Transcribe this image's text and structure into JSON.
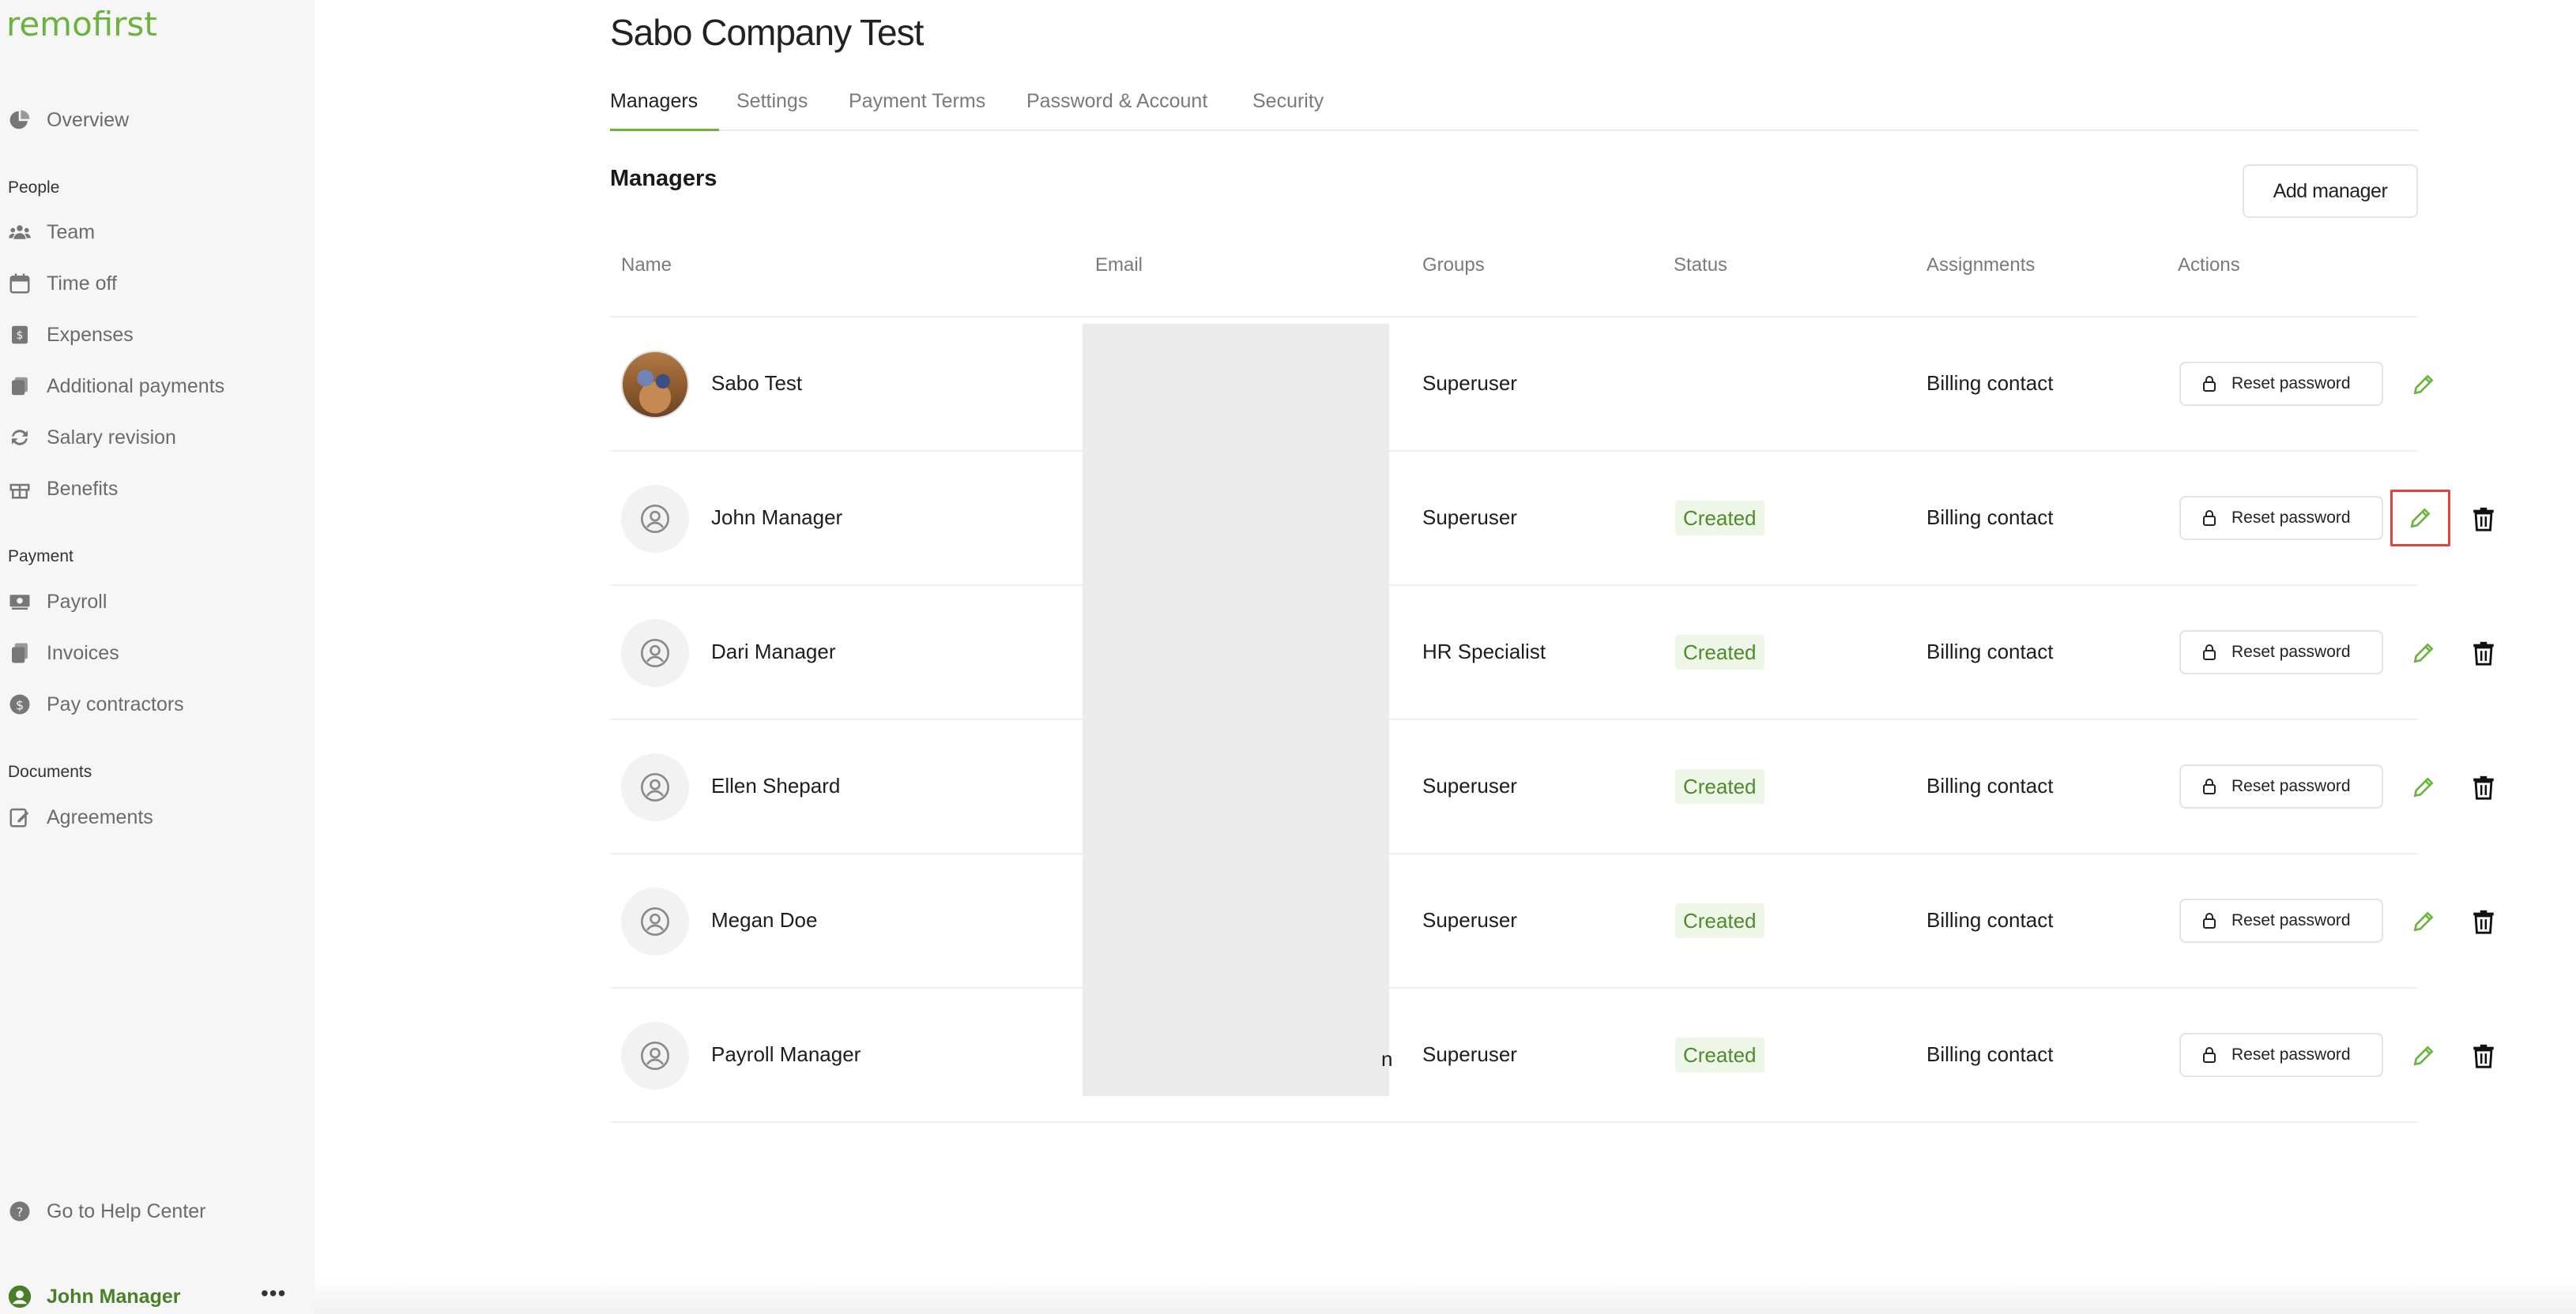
{
  "app": {
    "logo": "remofirst"
  },
  "sidebar": {
    "overview": "Overview",
    "sections": {
      "people": "People",
      "payment": "Payment",
      "documents": "Documents"
    },
    "people_items": [
      "Team",
      "Time off",
      "Expenses",
      "Additional payments",
      "Salary revision",
      "Benefits"
    ],
    "payment_items": [
      "Payroll",
      "Invoices",
      "Pay contractors"
    ],
    "documents_items": [
      "Agreements"
    ],
    "help": "Go to Help Center",
    "user": "John Manager",
    "more": "•••"
  },
  "page": {
    "title": "Sabo Company Test",
    "tabs": [
      "Managers",
      "Settings",
      "Payment Terms",
      "Password & Account",
      "Security"
    ],
    "section_title": "Managers",
    "add_button": "Add manager"
  },
  "table": {
    "headers": [
      "Name",
      "Email",
      "Groups",
      "Status",
      "Assignments",
      "Actions"
    ],
    "reset_label": "Reset password",
    "rows": [
      {
        "name": "Sabo Test",
        "group": "Superuser",
        "status": "",
        "assignment": "Billing contact"
      },
      {
        "name": "John Manager",
        "group": "Superuser",
        "status": "Created",
        "assignment": "Billing contact"
      },
      {
        "name": "Dari Manager",
        "group": "HR Specialist",
        "status": "Created",
        "assignment": "Billing contact"
      },
      {
        "name": "Ellen Shepard",
        "group": "Superuser",
        "status": "Created",
        "assignment": "Billing contact"
      },
      {
        "name": "Megan Doe",
        "group": "Superuser",
        "status": "Created",
        "assignment": "Billing contact"
      },
      {
        "name": "Payroll Manager",
        "group": "Superuser",
        "status": "Created",
        "assignment": "Billing contact"
      }
    ],
    "email_fragment": "n"
  },
  "colors": {
    "brand": "#6bb33f",
    "status_bg": "#eef6e8",
    "status_text": "#4f8a2d",
    "highlight": "#e0453a"
  }
}
